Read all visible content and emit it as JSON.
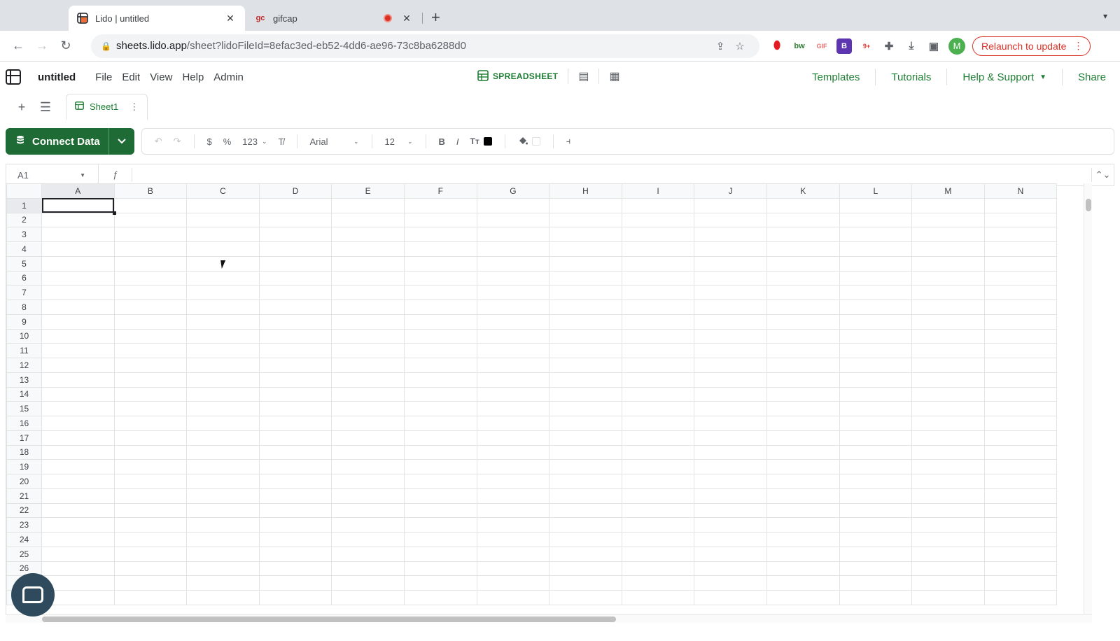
{
  "browser": {
    "tabs": [
      {
        "title": "Lido | untitled",
        "favicon": "lido-grid-icon",
        "active": true
      },
      {
        "title": "gifcap",
        "favicon_text": "gc",
        "active": false,
        "recording": true
      }
    ],
    "address": {
      "host": "sheets.lido.app",
      "path": "/sheet?lidoFileId=8efac3ed-eb52-4dd6-ae96-73c8ba6288d0"
    },
    "extensions": [
      "opera-icon",
      "bw-icon",
      "gif-icon",
      "extension-b-icon",
      "extension-9plus-icon",
      "puzzle-icon",
      "download-icon",
      "sidebar-icon"
    ],
    "avatar_letter": "M",
    "relaunch_label": "Relaunch to update"
  },
  "app": {
    "doc_title": "untitled",
    "menu": [
      "File",
      "Edit",
      "View",
      "Help",
      "Admin"
    ],
    "mode_label": "SPREADSHEET",
    "header_links": [
      "Templates",
      "Tutorials",
      "Help & Support",
      "Share"
    ],
    "sheet_tab": "Sheet1",
    "connect_label": "Connect Data",
    "toolbar": {
      "currency": "$",
      "percent": "%",
      "number_format": "123",
      "font": "Arial",
      "font_size": "12",
      "bold": "B",
      "italic": "I",
      "text_format": "Tт"
    },
    "name_box": "A1",
    "fx_symbol": "ƒ",
    "accent": "#1e7e34"
  },
  "grid": {
    "columns": [
      "A",
      "B",
      "C",
      "D",
      "E",
      "F",
      "G",
      "H",
      "I",
      "J",
      "K",
      "L",
      "M",
      "N"
    ],
    "rows": [
      "1",
      "2",
      "3",
      "4",
      "5",
      "6",
      "7",
      "8",
      "9",
      "10",
      "11",
      "12",
      "13",
      "14",
      "15",
      "16",
      "17",
      "18",
      "19",
      "20",
      "21",
      "22",
      "23",
      "24",
      "25",
      "26",
      "",
      ""
    ],
    "active_cell": "A1"
  }
}
